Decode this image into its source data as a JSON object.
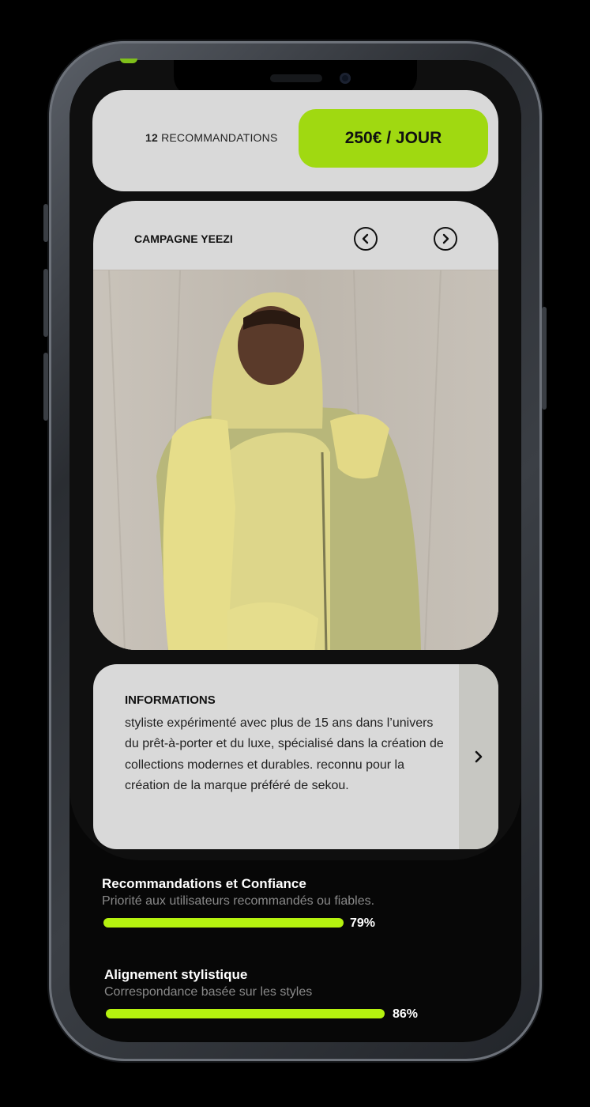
{
  "header": {
    "recommendations_count": "12",
    "recommendations_label": "RECOMMANDATIONS",
    "price_label": "250€ / JOUR"
  },
  "campaign": {
    "title": "CAMPAGNE YEEZI",
    "photo_alt": "photo"
  },
  "info": {
    "title": "INFORMATIONS",
    "text": "styliste expérimenté avec plus de 15 ans dans l’univers du prêt-à-porter et du luxe, spécialisé dans la création de collections modernes et durables. reconnu pour la création de la marque préféré de sekou."
  },
  "stats": [
    {
      "title": "Recommandations et Confiance",
      "subtitle": "Priorité aux utilisateurs recommandés ou fiables.",
      "value": 0.79,
      "value_label": "79%"
    },
    {
      "title": "Alignement stylistique",
      "subtitle": "Correspondance basée sur les styles",
      "value": 0.86,
      "value_label": "86%"
    }
  ],
  "colors": {
    "accent": "#a0d911",
    "bar": "#b5f20f",
    "card": "#d9d9d9"
  }
}
